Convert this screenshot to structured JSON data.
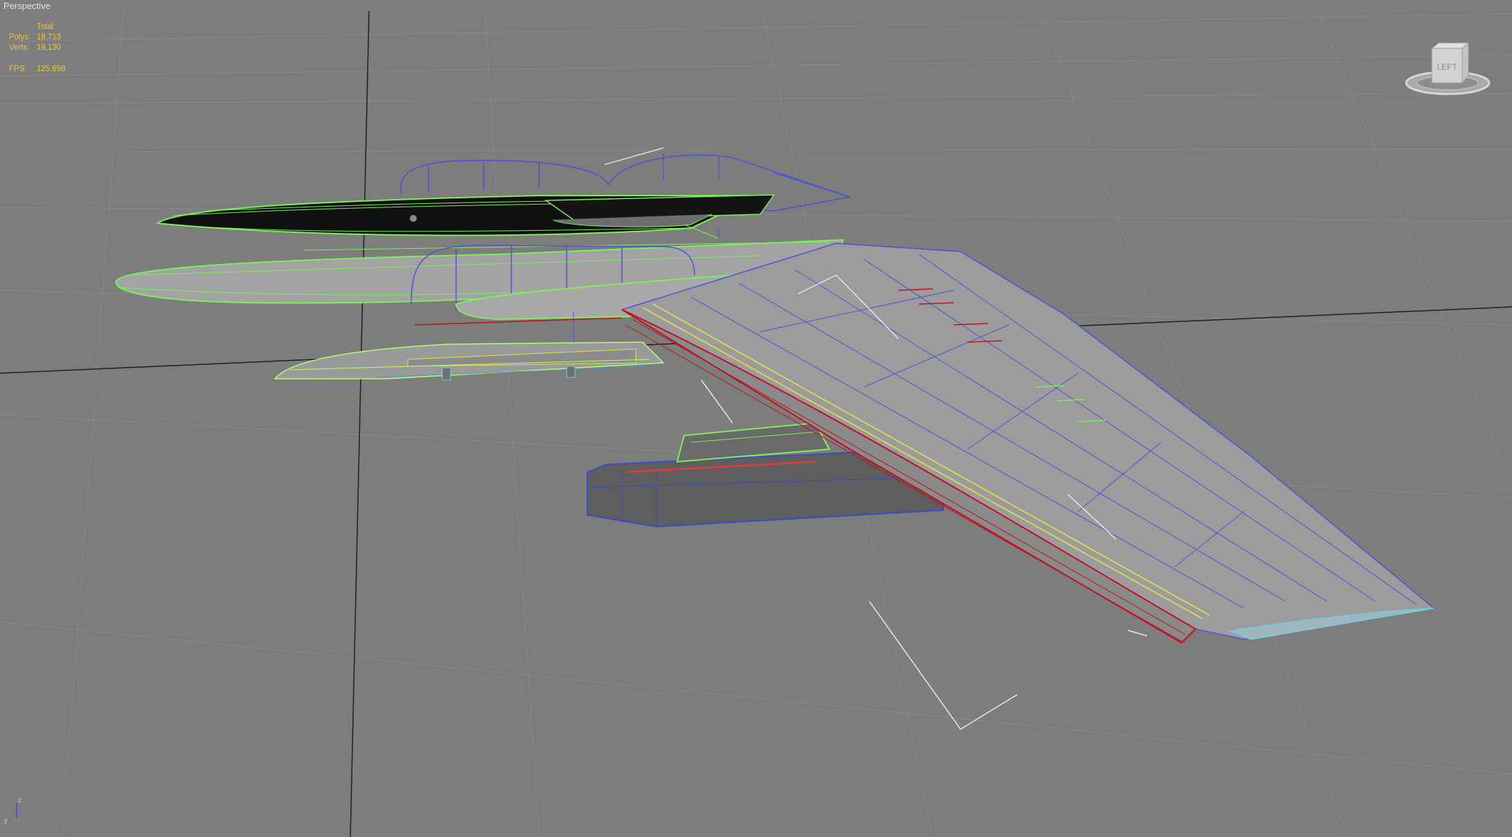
{
  "viewport": {
    "label": "Perspective"
  },
  "stats": {
    "header": "Total",
    "polys_label": "Polys:",
    "polys_value": "18,713",
    "verts_label": "Verts:",
    "verts_value": "19,130",
    "fps_label": "FPS:",
    "fps_value": "125.698"
  },
  "viewcube": {
    "face_label": "LEFT"
  },
  "axis_gizmo": {
    "z_label": "z",
    "y_label": "y"
  },
  "colors": {
    "background": "#7d7d7d",
    "grid": "#8e8e8e",
    "home_grid": "#1e1e1e",
    "stats_text": "#e8c84a",
    "wire_green": "#7cf05a",
    "wire_blue": "#5050d8",
    "wire_red": "#c01020",
    "wire_yellow": "#e6e640"
  }
}
